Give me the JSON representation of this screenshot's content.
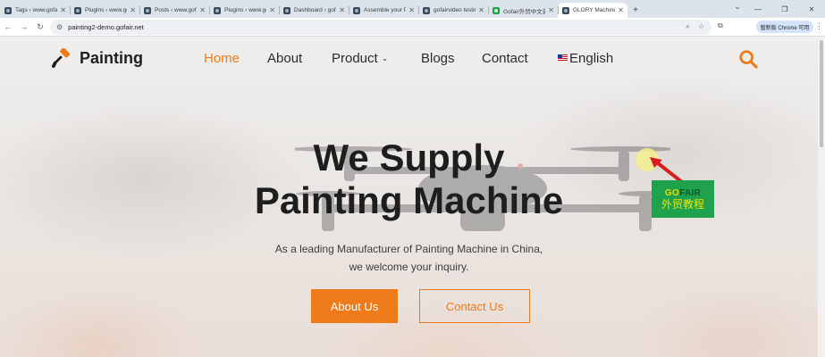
{
  "browser": {
    "tabs": [
      {
        "title": "Tags ‹ www.gofairvideo",
        "favicon": "site-favicon",
        "active": false
      },
      {
        "title": "Plugins ‹ www.gofairvideo",
        "favicon": "site-favicon",
        "active": false
      },
      {
        "title": "Posts ‹ www.gofairvideo",
        "favicon": "site-favicon",
        "active": false
      },
      {
        "title": "Plugins ‹ www.gofairvideo",
        "favicon": "site-favicon",
        "active": false
      },
      {
        "title": "Dashboard ‹ gofairvideo",
        "favicon": "site-favicon",
        "active": false
      },
      {
        "title": "Assemble your Pontoon",
        "favicon": "site-favicon",
        "active": false
      },
      {
        "title": "gofairvideo testing",
        "favicon": "site-favicon",
        "active": false
      },
      {
        "title": "Gofair外贸中文资讯",
        "favicon": "gofair-favicon",
        "active": false
      },
      {
        "title": "GLORY Machinery",
        "favicon": "site-favicon",
        "active": true
      }
    ],
    "new_tab_label": "+",
    "url": "painting2-demo.gofair.net",
    "profile_label": "暂新版 Chrome 可用"
  },
  "header": {
    "logo_text": "Painting",
    "logo_icon": "paint-roller-icon",
    "nav": [
      {
        "label": "Home",
        "active": true
      },
      {
        "label": "About",
        "active": false
      },
      {
        "label": "Product",
        "active": false,
        "has_dropdown": true
      },
      {
        "label": "Blogs",
        "active": false
      },
      {
        "label": "Contact",
        "active": false
      },
      {
        "label": "English",
        "active": false,
        "icon": "us-flag-icon"
      }
    ],
    "search_icon": "search-icon"
  },
  "hero": {
    "title_line1": "We Supply",
    "title_line2": "Painting Machine",
    "subtitle_line1": "As a leading Manufacturer of Painting Machine in China,",
    "subtitle_line2": "we welcome your inquiry.",
    "primary_button": "About Us",
    "secondary_button": "Contact Us"
  },
  "watermark": {
    "go": "GO",
    "fair": "FAIR",
    "cn": "外贸教程"
  },
  "colors": {
    "accent": "#ef7a1a",
    "watermark_green": "#1ea24d",
    "text_dark": "#1e1e1e"
  }
}
